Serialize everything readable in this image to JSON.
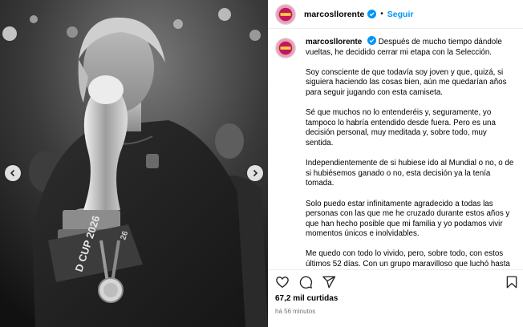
{
  "post": {
    "username": "marcosllorente",
    "follow_label": "Seguir",
    "separator": "•",
    "caption": {
      "username": "marcosllorente",
      "p1": "Después de mucho tiempo dándole vueltas, he decidido cerrar mi etapa con la Selección.",
      "p2": "Soy consciente de que todavía soy joven y que, quizá, si siguiera haciendo las cosas bien, aún me quedarían años para seguir jugando con esta camiseta.",
      "p3": "Sé que muchos no lo entenderéis y, seguramente, yo tampoco lo habría entendido desde fuera. Pero es una decisión personal, muy meditada y, sobre todo, muy sentida.",
      "p4": "Independientemente de si hubiese ido al Mundial o no, o de si hubiésemos ganado o no, esta decisión ya la tenía tomada.",
      "p5": "Solo puedo estar infinitamente agradecido a todas las personas con las que me he cruzado durante estos años y que han hecho posible que mi familia y yo podamos vivir momentos únicos e inolvidables.",
      "p6": "Me quedo con todo lo vivido, pero, sobre todo, con estos últimos 52 días. Con un grupo maravilloso que luchó hasta el final por dejar a España en lo más alto. Y así lo hizo."
    },
    "likes": "67,2 mil curtidas",
    "time": "há 56 minutos"
  },
  "photo": {
    "trophy_text": "D CUP 2026",
    "trophy_text_2": "26"
  },
  "colors": {
    "link_blue": "#0095f6",
    "verified_blue": "#0095f6",
    "secondary_text": "#737373",
    "divider": "#efefef"
  },
  "icons": {
    "like": "heart-icon",
    "comment": "comment-icon",
    "share": "share-icon",
    "save": "bookmark-icon",
    "verified": "verified-badge-icon",
    "prev": "chevron-left-icon",
    "next": "chevron-right-icon"
  }
}
